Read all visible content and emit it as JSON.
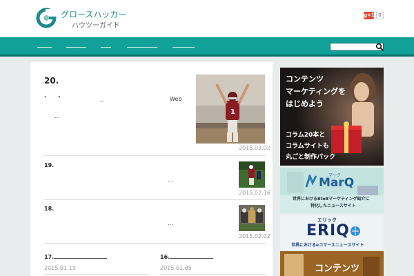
{
  "header": {
    "logo_title": "グロースハッカー",
    "logo_sub": "ハウツーガイド",
    "gplus_label": "g+1",
    "gplus_count": "0"
  },
  "nav": {
    "items": [
      "",
      "",
      "",
      "",
      ""
    ]
  },
  "posts": {
    "featured": {
      "number": "20.",
      "line1_a": "\"",
      "line1_b": "\"",
      "line1_c": "...",
      "line1_d": "Web",
      "line2": "...",
      "date": "2015.03.02"
    },
    "p19": {
      "number": "19.",
      "ellipsis": "...",
      "date": "2015.02.16"
    },
    "p18": {
      "number": "18.",
      "ellipsis": "...",
      "date": "2015.02.02"
    },
    "p17": {
      "number": "17.",
      "date": "2015.01.19"
    },
    "p16": {
      "number": "16.",
      "date": "2015.01.05"
    }
  },
  "sidebar": {
    "ad1": {
      "lines": [
        "コンテンツ",
        "マーケティングを",
        "はじめよう"
      ],
      "lower": [
        "コラム20本と",
        "コラムサイトも",
        "丸ごと制作パック"
      ]
    },
    "ad2": {
      "ruby": "マーク",
      "brand": "MarQ",
      "caption1": "世界におけるBtoBマーケティング紹介に",
      "caption2": "特化したニュースサイト"
    },
    "ad3": {
      "ruby": "エリック",
      "brand": "ERIQ",
      "caption": "世界におけるeコマースニュースサイト"
    },
    "ad4": {
      "text": "コンテンツ"
    }
  },
  "colors": {
    "nav_bg": "#12a198",
    "nav_border": "#0a6f69",
    "brand_teal": "#1a8c8a",
    "date_grey": "#999999"
  }
}
